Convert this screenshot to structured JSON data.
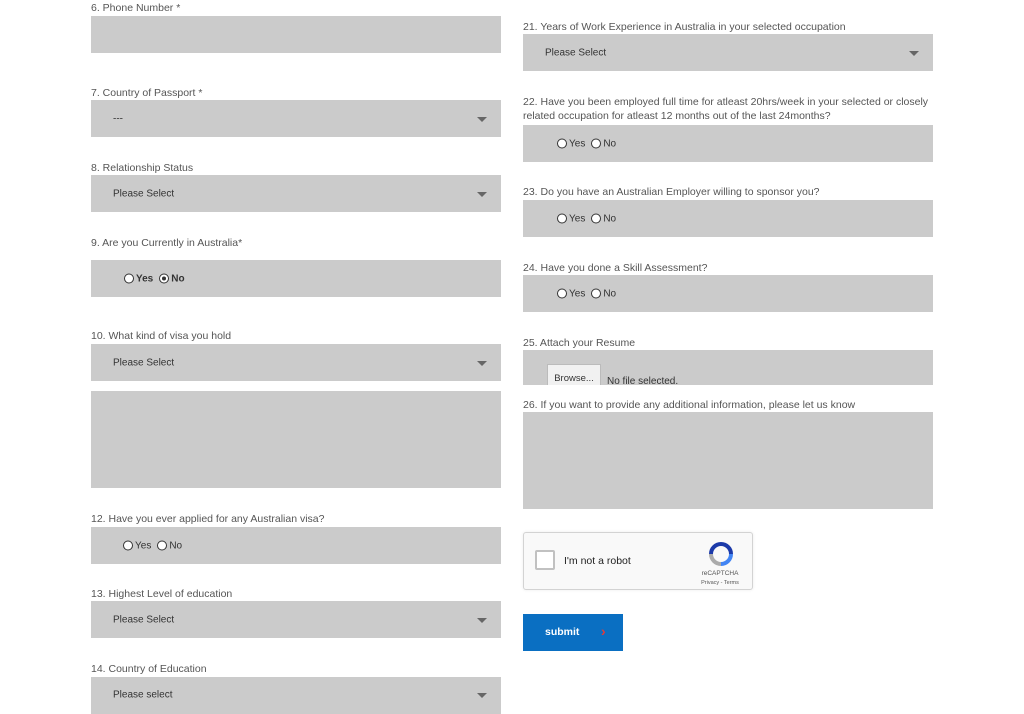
{
  "left": {
    "phone": {
      "label": "6. Phone Number *"
    },
    "passport": {
      "label": "7. Country of Passport *",
      "value": "---"
    },
    "relationship": {
      "label": "8. Relationship Status",
      "value": "Please Select"
    },
    "in_australia": {
      "label": "9. Are you Currently in Australia*",
      "yes": "Yes",
      "no": "No",
      "selected": "No"
    },
    "visa": {
      "label": "10. What kind of visa you hold",
      "value": "Please Select"
    },
    "applied_visa": {
      "label": "12. Have you ever applied for any Australian visa?",
      "yes": "Yes",
      "no": "No"
    },
    "education": {
      "label": "13. Highest Level of education",
      "value": "Please Select"
    },
    "edu_country": {
      "label": "14. Country of Education",
      "value": "Please select"
    }
  },
  "right": {
    "experience": {
      "label": "21. Years of Work Experience in Australia in your selected occupation",
      "value": "Please Select"
    },
    "employed": {
      "label": "22. Have you been employed full time for atleast 20hrs/week in your selected or closely related occupation for atleast 12 months out of the last 24months?",
      "yes": "Yes",
      "no": "No"
    },
    "employer": {
      "label": "23. Do you have an Australian Employer willing to sponsor you?",
      "yes": "Yes",
      "no": "No"
    },
    "skill": {
      "label": "24. Have you done a Skill Assessment?",
      "yes": "Yes",
      "no": "No"
    },
    "resume": {
      "label": "25. Attach your Resume",
      "browse": "Browse...",
      "status": "No file selected."
    },
    "additional": {
      "label": "26. If you want to provide any additional information, please let us know"
    }
  },
  "recaptcha": {
    "text": "I'm not a robot",
    "brand": "reCAPTCHA",
    "links": "Privacy - Terms"
  },
  "submit": {
    "label": "submit",
    "arrow": "›"
  },
  "colors": {
    "field_bg": "#cbcbcb",
    "submit_bg": "#0a6fc2",
    "arrow": "#e23b3b"
  }
}
